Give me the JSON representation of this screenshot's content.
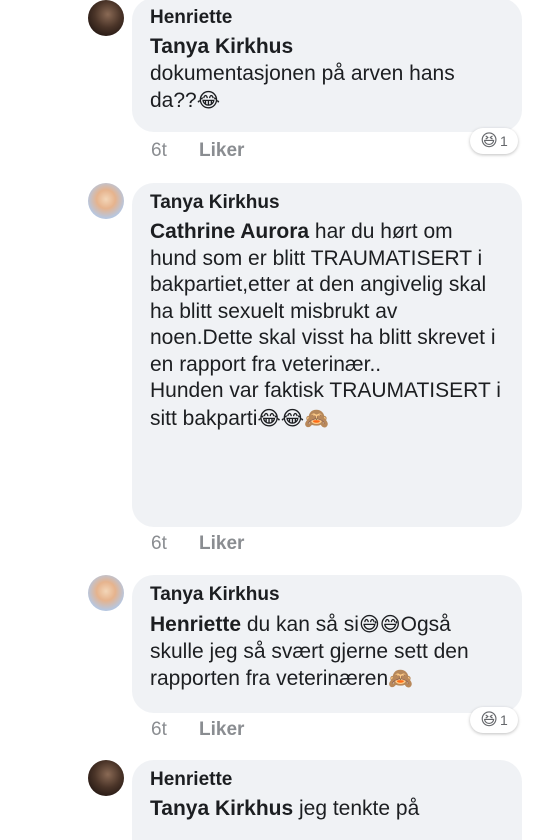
{
  "comments": [
    {
      "author": "Henriette",
      "mention": "Tanya Kirkhus",
      "text": " dokumentasjonen på arven hans da??",
      "text_emoji": "😂",
      "time": "6t",
      "like": "Liker",
      "reaction_emoji": "😆",
      "reaction_count": "1"
    },
    {
      "author": "Tanya Kirkhus",
      "mention": "Cathrine Aurora",
      "text": " har du hørt om hund som er blitt TRAUMATISERT i bakpartiet,etter at den angivelig skal ha blitt sexuelt misbrukt av noen.Dette skal visst ha blitt skrevet i en rapport fra veterinær..",
      "text2": "Hunden var faktisk TRAUMATISERT i sitt bakparti",
      "text_emoji": "😂😂🙈",
      "time": "6t",
      "like": "Liker"
    },
    {
      "author": "Tanya Kirkhus",
      "mention": "Henriette",
      "text": " du kan så si",
      "emoji_a": "😅😅",
      "text_b": "Også skulle jeg så svært gjerne sett den rapporten fra veterinæren",
      "emoji_b": "🙈",
      "time": "6t",
      "like": "Liker",
      "reaction_emoji": "😆",
      "reaction_count": "1"
    },
    {
      "author": "Henriette",
      "mention": "Tanya Kirkhus",
      "text": " jeg tenkte på"
    }
  ]
}
